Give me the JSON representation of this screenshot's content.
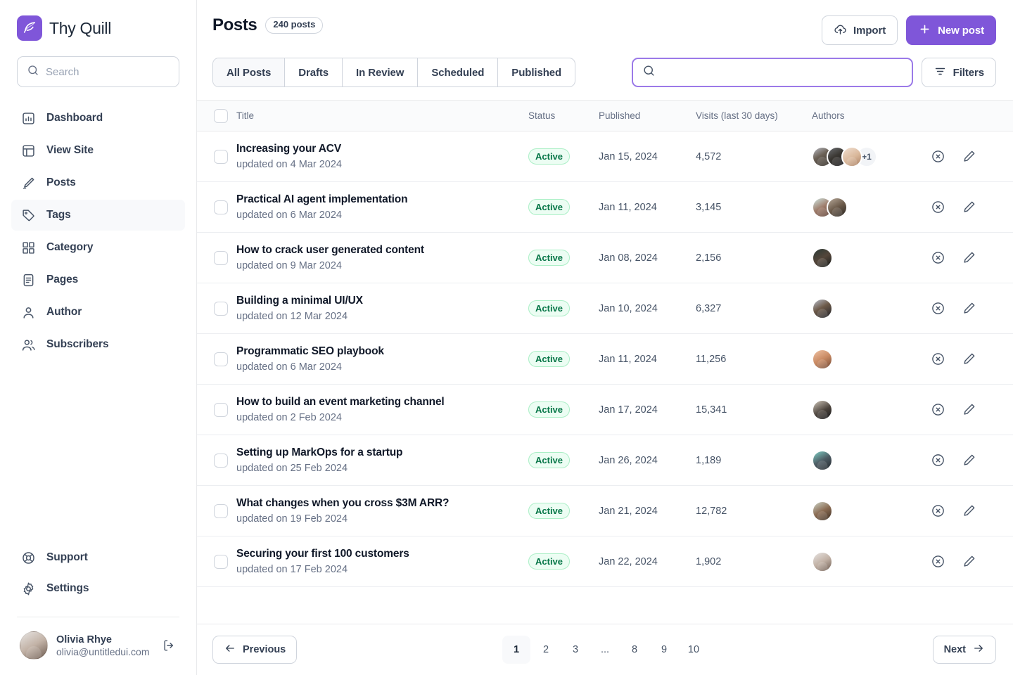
{
  "brand": {
    "name": "Thy Quill",
    "logo_icon": "quill-feather-icon",
    "accent_color": "#7F56D9"
  },
  "sidebar": {
    "search": {
      "placeholder": "Search",
      "value": ""
    },
    "items": [
      {
        "label": "Dashboard",
        "icon": "bar-chart-icon",
        "active": false
      },
      {
        "label": "View Site",
        "icon": "layout-icon",
        "active": false
      },
      {
        "label": "Posts",
        "icon": "pencil-icon",
        "active": false
      },
      {
        "label": "Tags",
        "icon": "tag-icon",
        "active": true
      },
      {
        "label": "Category",
        "icon": "grid-icon",
        "active": false
      },
      {
        "label": "Pages",
        "icon": "file-text-icon",
        "active": false
      },
      {
        "label": "Author",
        "icon": "user-icon",
        "active": false
      },
      {
        "label": "Subscribers",
        "icon": "users-icon",
        "active": false
      }
    ],
    "bottom_items": [
      {
        "label": "Support",
        "icon": "lifebuoy-icon"
      },
      {
        "label": "Settings",
        "icon": "gear-icon"
      }
    ],
    "user": {
      "name": "Olivia Rhye",
      "email": "olivia@untitledui.com",
      "logout_icon": "logout-icon"
    }
  },
  "header": {
    "title": "Posts",
    "count_badge": "240 posts",
    "import_label": "Import",
    "import_icon": "cloud-upload-icon",
    "new_post_label": "New post",
    "new_post_icon": "plus-icon"
  },
  "toolbar": {
    "tabs": [
      {
        "label": "All Posts",
        "active": true
      },
      {
        "label": "Drafts",
        "active": false
      },
      {
        "label": "In Review",
        "active": false
      },
      {
        "label": "Scheduled",
        "active": false
      },
      {
        "label": "Published",
        "active": false
      }
    ],
    "search": {
      "placeholder": "",
      "value": "",
      "icon": "search-icon",
      "focused": true
    },
    "filters_label": "Filters",
    "filters_icon": "filter-lines-icon"
  },
  "table": {
    "columns": [
      "Title",
      "Status",
      "Published",
      "Visits (last 30 days)",
      "Authors"
    ],
    "status_colors": {
      "active_bg": "#ECFDF3",
      "active_border": "#ABEFC6",
      "active_text": "#067647"
    },
    "row_actions": {
      "delete_icon": "x-circle-icon",
      "edit_icon": "pencil-edit-icon"
    },
    "rows": [
      {
        "title": "Increasing your ACV",
        "subtitle": "updated on 4 Mar 2024",
        "status": "Active",
        "published": "Jan 15, 2024",
        "visits": "4,572",
        "authors": 3,
        "extra_authors": "+1"
      },
      {
        "title": "Practical AI agent implementation",
        "subtitle": "updated on 6 Mar 2024",
        "status": "Active",
        "published": "Jan 11, 2024",
        "visits": "3,145",
        "authors": 2,
        "extra_authors": ""
      },
      {
        "title": "How to crack user generated content",
        "subtitle": "updated on 9 Mar 2024",
        "status": "Active",
        "published": "Jan 08, 2024",
        "visits": "2,156",
        "authors": 1,
        "extra_authors": ""
      },
      {
        "title": "Building a minimal UI/UX",
        "subtitle": "updated on 12 Mar 2024",
        "status": "Active",
        "published": "Jan 10, 2024",
        "visits": "6,327",
        "authors": 1,
        "extra_authors": ""
      },
      {
        "title": "Programmatic SEO playbook",
        "subtitle": "updated on 6 Mar 2024",
        "status": "Active",
        "published": "Jan 11, 2024",
        "visits": "11,256",
        "authors": 1,
        "extra_authors": ""
      },
      {
        "title": "How to build an event marketing channel",
        "subtitle": "updated on 2 Feb 2024",
        "status": "Active",
        "published": "Jan 17, 2024",
        "visits": "15,341",
        "authors": 1,
        "extra_authors": ""
      },
      {
        "title": "Setting up MarkOps for a startup",
        "subtitle": "updated on 25 Feb 2024",
        "status": "Active",
        "published": "Jan 26, 2024",
        "visits": "1,189",
        "authors": 1,
        "extra_authors": ""
      },
      {
        "title": "What changes when you cross $3M ARR?",
        "subtitle": "updated on 19 Feb 2024",
        "status": "Active",
        "published": "Jan 21, 2024",
        "visits": "12,782",
        "authors": 1,
        "extra_authors": ""
      },
      {
        "title": "Securing your first 100 customers",
        "subtitle": "updated on 17 Feb 2024",
        "status": "Active",
        "published": "Jan 22, 2024",
        "visits": "1,902",
        "authors": 1,
        "extra_authors": ""
      }
    ]
  },
  "pagination": {
    "previous_label": "Previous",
    "next_label": "Next",
    "pages": [
      "1",
      "2",
      "3",
      "...",
      "8",
      "9",
      "10"
    ],
    "current_page": "1"
  }
}
